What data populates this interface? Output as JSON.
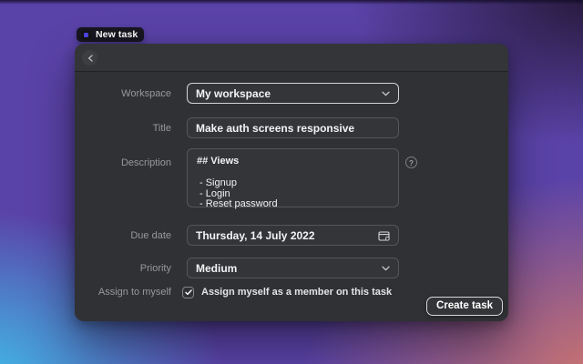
{
  "pill": {
    "label": "New task"
  },
  "window": {
    "form": {
      "workspace": {
        "label": "Workspace",
        "value": "My workspace"
      },
      "title": {
        "label": "Title",
        "value": "Make auth screens responsive"
      },
      "description": {
        "label": "Description",
        "heading": "## Views",
        "lines": [
          "- Signup",
          "- Login",
          "- Reset password"
        ]
      },
      "due_date": {
        "label": "Due date",
        "value": "Thursday, 14 July 2022"
      },
      "priority": {
        "label": "Priority",
        "value": "Medium"
      },
      "assign": {
        "label": "Assign to myself",
        "text": "Assign myself as a member on this task",
        "checked": true
      }
    },
    "footer": {
      "create_button": "Create task"
    }
  },
  "icons": {
    "help": "?"
  },
  "colors": {
    "background_purple": "#5a43a8",
    "background_cyan": "#3fc3ec",
    "background_salmon": "#d4786a",
    "background_dark_violet": "#251838",
    "window_bg": "#303134",
    "field_border": "#55565a",
    "focused_field_border": "#d3d4d6",
    "label_text": "#98989b",
    "value_text": "#f2f3f5",
    "accent_blue": "#4f46e5"
  }
}
